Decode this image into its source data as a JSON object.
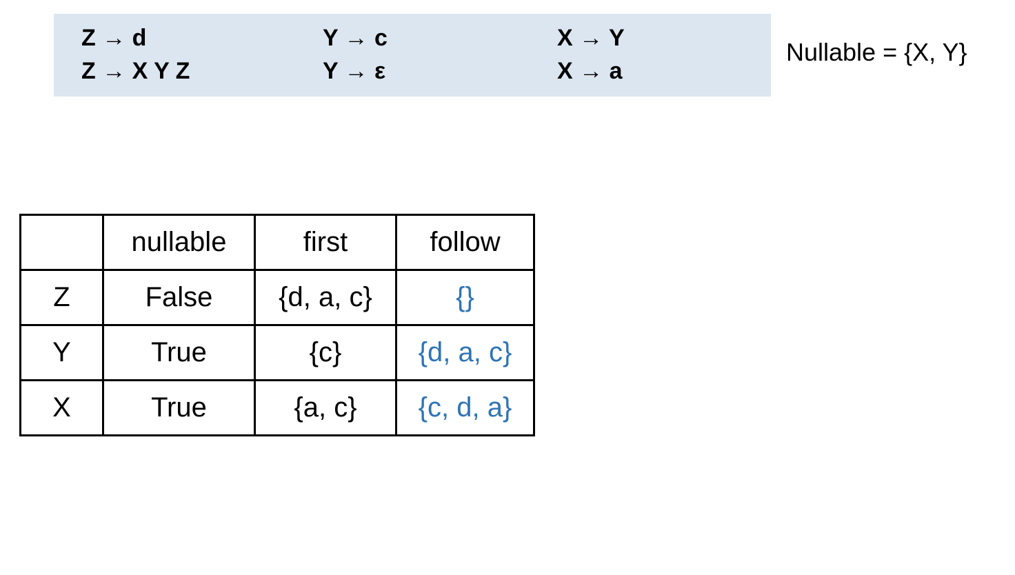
{
  "grammar": {
    "col1": {
      "line1": "Z → d",
      "line2": "Z → X Y Z"
    },
    "col2": {
      "line1": "Y → c",
      "line2": "Y → ε"
    },
    "col3": {
      "line1": "X → Y",
      "line2": "X → a"
    }
  },
  "nullable_note": "Nullable = {X, Y}",
  "table": {
    "headers": {
      "blank": "",
      "nullable": "nullable",
      "first": "first",
      "follow": "follow"
    },
    "rows": [
      {
        "sym": "Z",
        "nullable": "False",
        "first": "{d, a, c}",
        "follow": "{}"
      },
      {
        "sym": "Y",
        "nullable": "True",
        "first": "{c}",
        "follow": "{d, a, c}"
      },
      {
        "sym": "X",
        "nullable": "True",
        "first": "{a, c}",
        "follow": "{c, d, a}"
      }
    ]
  },
  "colors": {
    "highlight": "#2e74b5",
    "panel": "#dce6f0"
  }
}
